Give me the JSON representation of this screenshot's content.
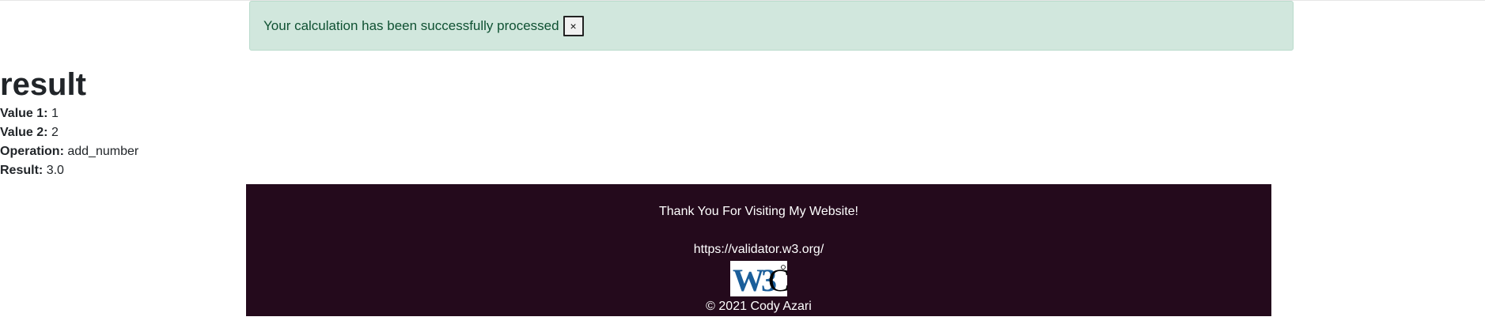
{
  "alert": {
    "message": "Your calculation has been successfully processed",
    "close_label": "×"
  },
  "result": {
    "title": "result",
    "fields": [
      {
        "label": "Value 1:",
        "value": "1"
      },
      {
        "label": "Value 2:",
        "value": "2"
      },
      {
        "label": "Operation:",
        "value": "add_number"
      },
      {
        "label": "Result:",
        "value": "3.0"
      }
    ]
  },
  "footer": {
    "thanks": "Thank You For Visiting My Website!",
    "validator_link": "https://validator.w3.org/",
    "badge_text": "W3C",
    "copyright": "© 2021 Cody Azari"
  },
  "colors": {
    "alert_bg": "#d1e7dd",
    "alert_text": "#0f5132",
    "footer_bg": "#240a1c",
    "w3c_blue": "#1a5e9a"
  }
}
